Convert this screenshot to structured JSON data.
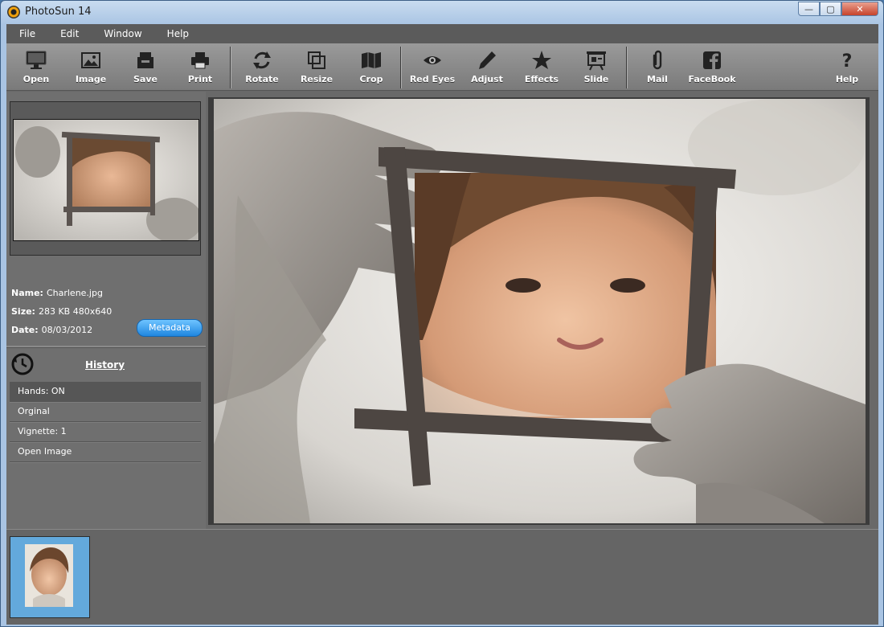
{
  "window": {
    "title": "PhotoSun 14",
    "buttons": {
      "minimize": "—",
      "maximize": "▢",
      "close": "✕"
    }
  },
  "menu": [
    "File",
    "Edit",
    "Window",
    "Help"
  ],
  "toolbar": [
    {
      "label": "Open",
      "icon": "monitor-icon"
    },
    {
      "label": "Image",
      "icon": "image-icon"
    },
    {
      "label": "Save",
      "icon": "save-tray-icon"
    },
    {
      "label": "Print",
      "icon": "printer-icon"
    },
    {
      "label": "Rotate",
      "icon": "rotate-icon"
    },
    {
      "label": "Resize",
      "icon": "resize-icon"
    },
    {
      "label": "Crop",
      "icon": "crop-map-icon"
    },
    {
      "label": "Red Eyes",
      "icon": "eye-icon"
    },
    {
      "label": "Adjust",
      "icon": "pencil-icon"
    },
    {
      "label": "Effects",
      "icon": "star-icon"
    },
    {
      "label": "Slide",
      "icon": "slideshow-icon"
    },
    {
      "label": "Mail",
      "icon": "paperclip-icon"
    },
    {
      "label": "FaceBook",
      "icon": "facebook-icon"
    },
    {
      "label": "Help",
      "icon": "question-icon"
    }
  ],
  "file_info": {
    "name_label": "Name:",
    "name": "Charlene.jpg",
    "size_label": "Size:",
    "size": "283 KB  480x640",
    "date_label": "Date:",
    "date": "08/03/2012"
  },
  "metadata_button": "Metadata",
  "history": {
    "title": "History",
    "items": [
      "Hands: ON",
      "Orginal",
      "Vignette: 1",
      "Open Image"
    ],
    "active_index": 0
  },
  "colors": {
    "accent": "#1f86e0",
    "panel": "#6f6f6f",
    "toolbar": "#8a8a8a"
  }
}
